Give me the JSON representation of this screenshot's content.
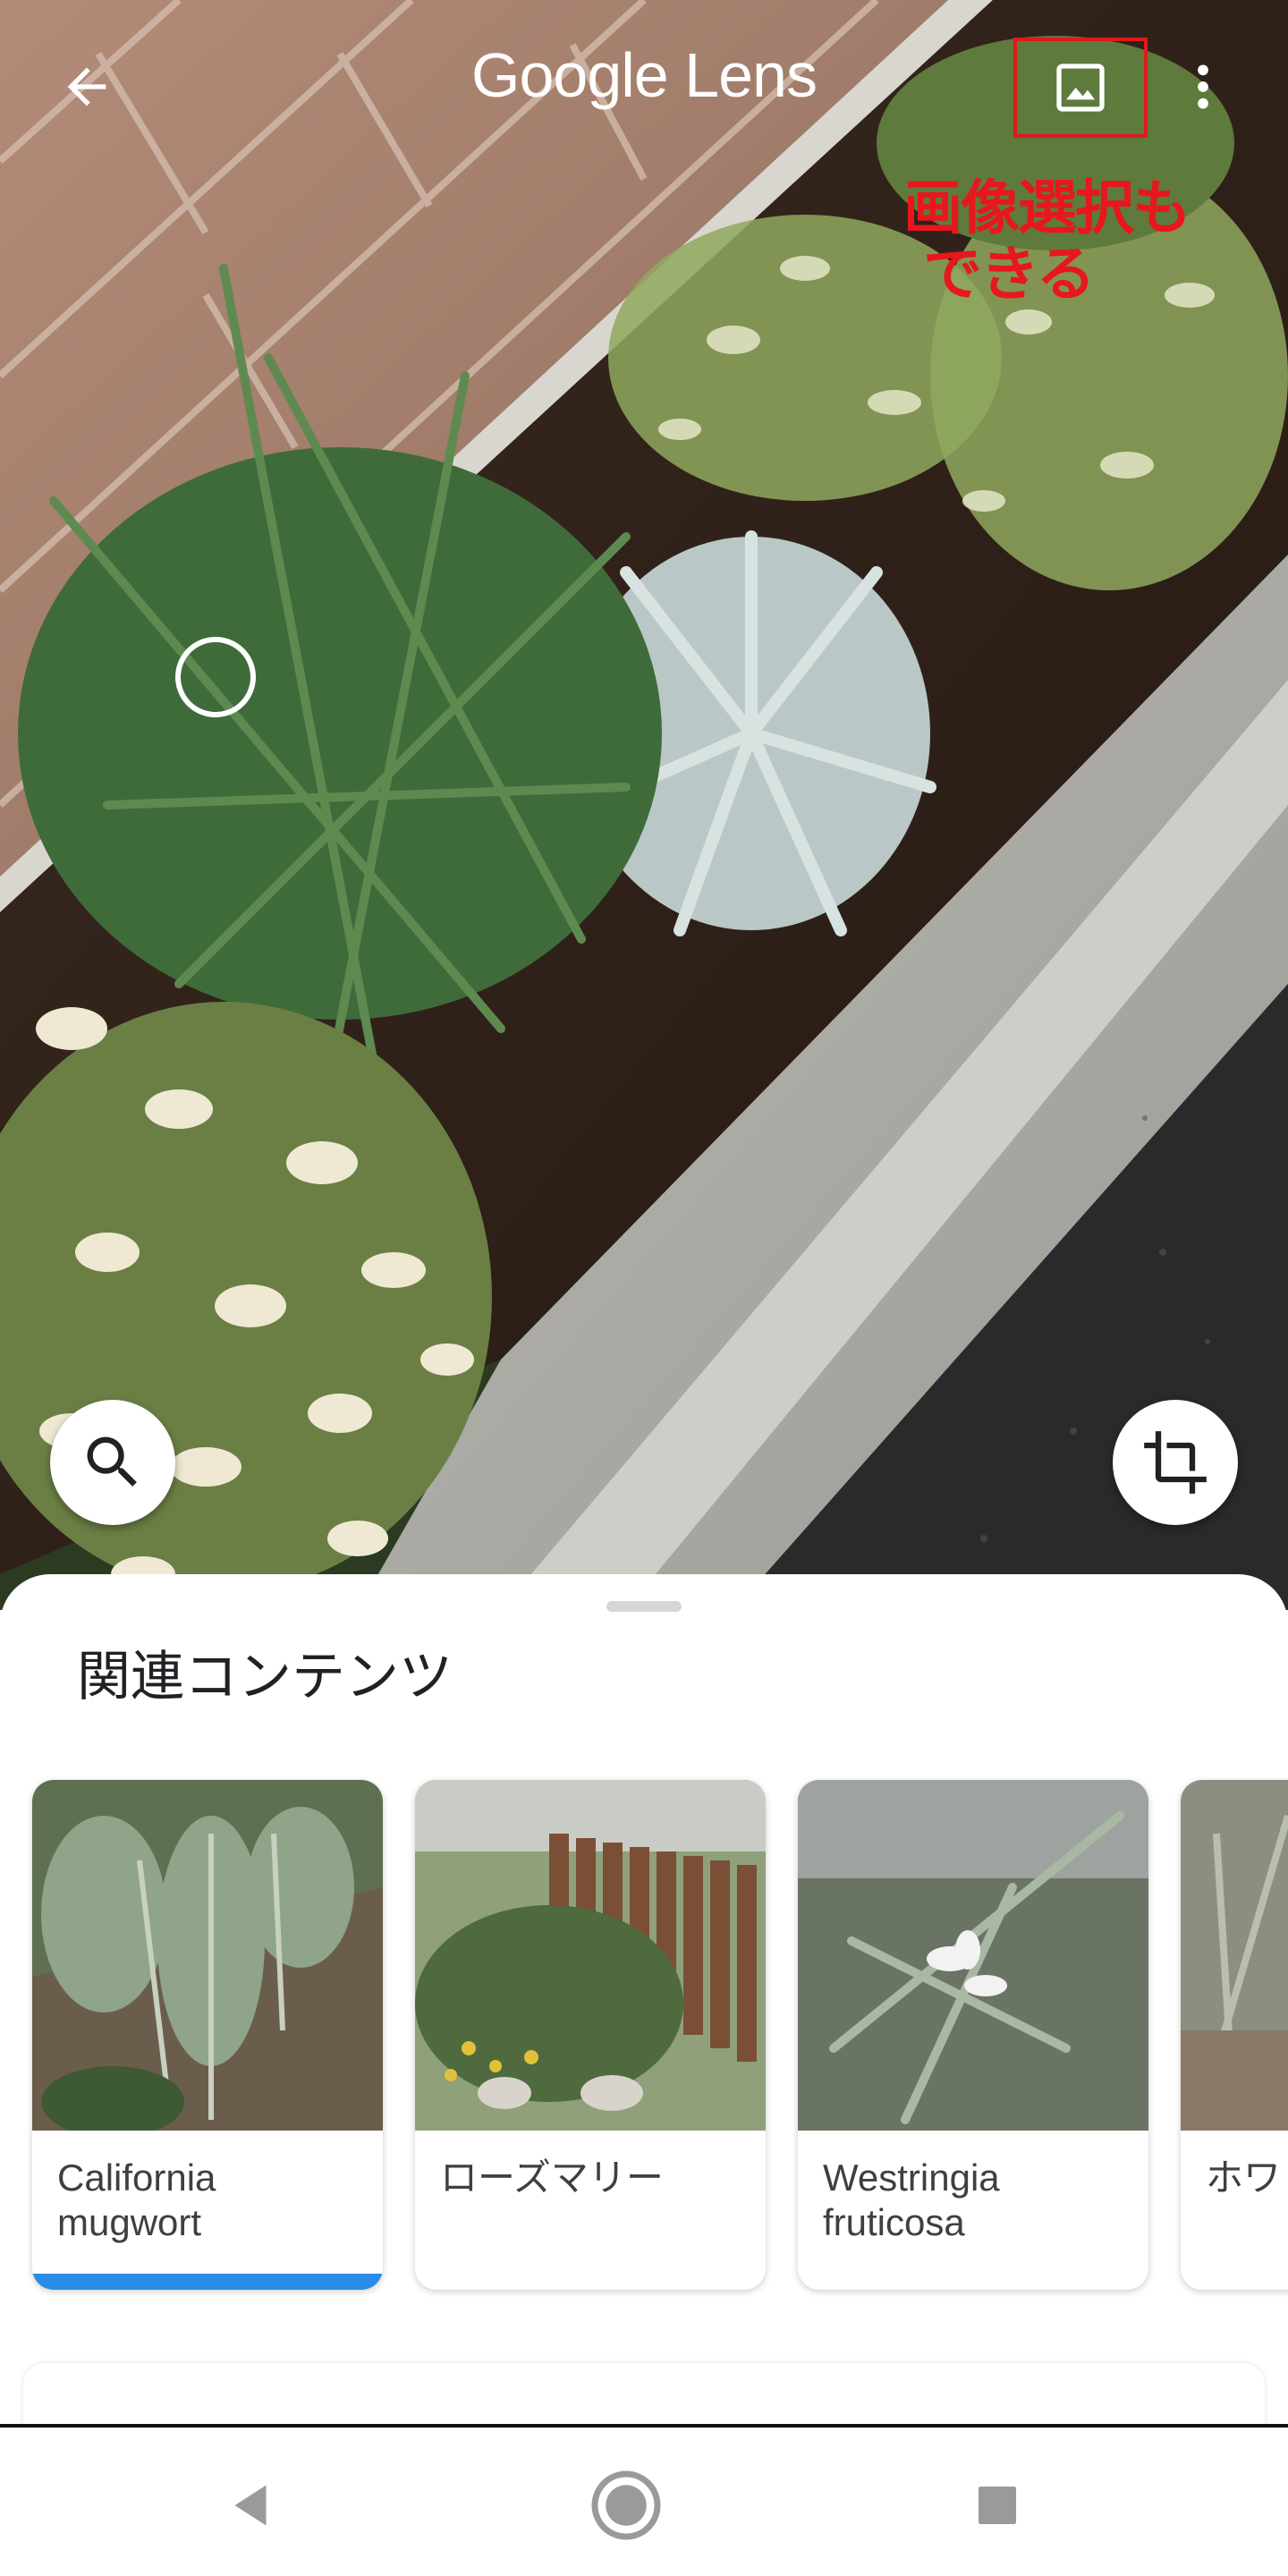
{
  "app": {
    "title": "Google Lens"
  },
  "annotation": {
    "line1": "画像選択も",
    "line2": "できる",
    "color": "#e8161d"
  },
  "icons": {
    "back": "arrow-back-icon",
    "gallery": "image-gallery-icon",
    "menu": "more-vert-icon",
    "search": "search-icon",
    "crop": "crop-icon"
  },
  "sheet": {
    "title": "関連コンテンツ",
    "cards": [
      {
        "label": "California mugwort",
        "selected": true
      },
      {
        "label": "ローズマリー",
        "selected": false
      },
      {
        "label": "Westringia fruticosa",
        "selected": false
      },
      {
        "label": "ホワ",
        "selected": false
      }
    ],
    "accent": "#2b8be6"
  },
  "navbar": {
    "back": "nav-back-icon",
    "home": "nav-home-icon",
    "recent": "nav-recent-icon"
  }
}
